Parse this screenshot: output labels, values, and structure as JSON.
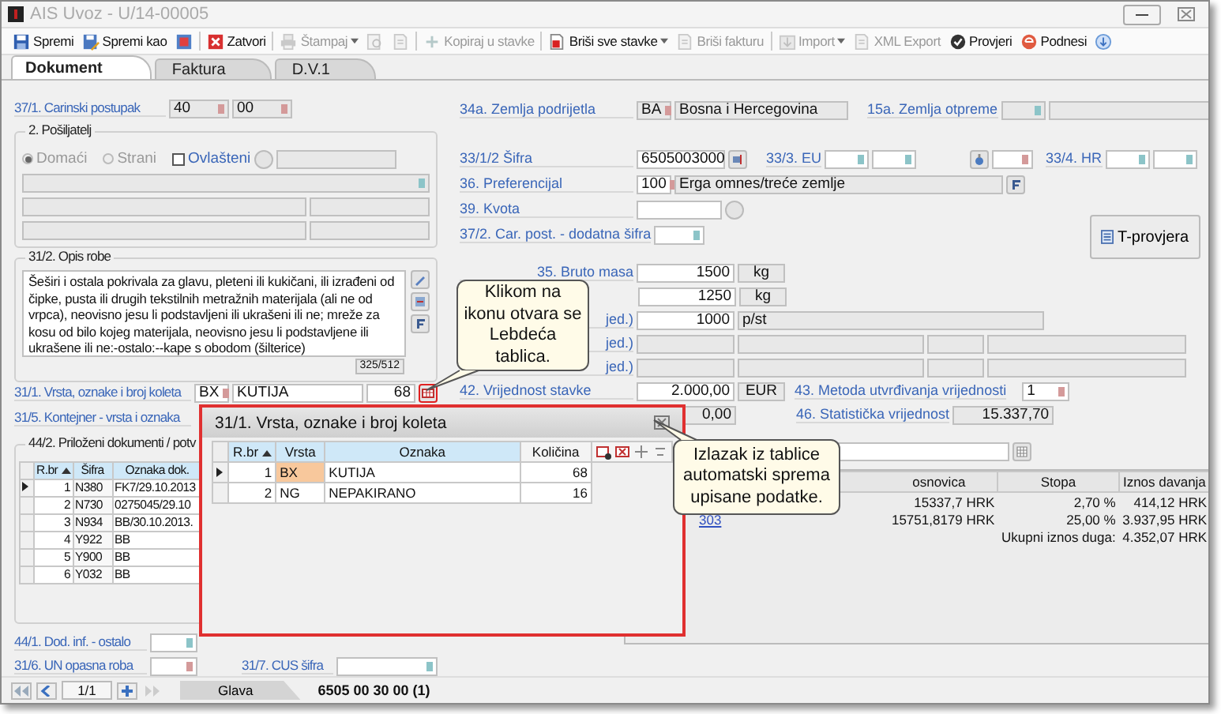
{
  "window": {
    "title": "AIS Uvoz - U/14-00005"
  },
  "toolbar": [
    {
      "kind": "save",
      "label": "Spremi",
      "disabled": false
    },
    {
      "kind": "saveas",
      "label": "Spremi kao",
      "disabled": false
    },
    {
      "kind": "export",
      "disabled": false
    },
    {
      "kind": "separator"
    },
    {
      "kind": "close",
      "label": "Zatvori",
      "disabled": false
    },
    {
      "kind": "separator"
    },
    {
      "kind": "print",
      "label": "Štampaj",
      "disabled": true,
      "dropdown": true
    },
    {
      "kind": "preview",
      "disabled": true
    },
    {
      "kind": "page",
      "disabled": true
    },
    {
      "kind": "separator"
    },
    {
      "kind": "copy",
      "label": "Kopiraj u stavke",
      "disabled": true
    },
    {
      "kind": "separator"
    },
    {
      "kind": "delete",
      "label": "Briši sve stavke",
      "disabled": false,
      "dropdown": true
    },
    {
      "kind": "page",
      "label": "Briši fakturu",
      "disabled": true
    },
    {
      "kind": "separator"
    },
    {
      "kind": "import",
      "label": "Import",
      "disabled": true,
      "dropdown": true
    },
    {
      "kind": "page",
      "label": "XML Export",
      "disabled": true
    },
    {
      "kind": "check",
      "label": "Provjeri",
      "disabled": false
    },
    {
      "kind": "submit",
      "label": "Podnesi",
      "disabled": false
    },
    {
      "kind": "info",
      "disabled": false
    }
  ],
  "tabs": [
    {
      "label": "Dokument",
      "selected": true
    },
    {
      "label": "Faktura",
      "selected": false
    },
    {
      "label": "D.V.1",
      "selected": false
    }
  ],
  "left": {
    "carinski_postupak": {
      "label": "37/1. Carinski postupak",
      "values": [
        "40",
        "00"
      ]
    },
    "posiljatelj": {
      "title": "2. Pošiljatelj",
      "options": [
        {
          "label": "Domaći",
          "selected": true
        },
        {
          "label": "Strani",
          "selected": false
        }
      ],
      "ovlasteni": {
        "label": "Ovlašteni",
        "checked": false
      }
    },
    "opis_robe": {
      "title": "31/2. Opis robe",
      "text": "Šeširi i ostala pokrivala za glavu, pleteni ili kukičani, ili izrađeni od čipke, pusta ili drugih tekstilnih metražnih materijala (ali ne od vrpca), neovisno jesu li podstavljeni ili ukrašeni ili ne; mreže za kosu od bilo kojeg materijala, neovisno jesu li podstavljene ili ukrašene ili ne:-ostalo:--kape s obodom (šilterice)",
      "counter": "325/512"
    },
    "koleta": {
      "label": "31/1. Vrsta, oznake i broj koleta",
      "code": "BX",
      "name": "KUTIJA",
      "count": "68"
    },
    "kontejner": {
      "label": "31/5. Kontejner - vrsta i oznaka"
    },
    "prilozeni": {
      "title": "44/2. Priloženi dokumenti / potv",
      "columns": [
        {
          "label": "R.br",
          "sorted": true
        },
        {
          "label": "Šifra",
          "sorted": false
        },
        {
          "label": "Oznaka dok.",
          "sorted": false
        }
      ],
      "rows": [
        {
          "cells": [
            "1",
            "N380",
            "FK7/29.10.2013"
          ],
          "selected": true
        },
        {
          "cells": [
            "2",
            "N730",
            "0275045/29.10"
          ],
          "selected": false
        },
        {
          "cells": [
            "3",
            "N934",
            "BB/30.10.2013."
          ],
          "selected": false
        },
        {
          "cells": [
            "4",
            "Y922",
            "BB"
          ],
          "selected": false
        },
        {
          "cells": [
            "5",
            "Y900",
            "BB"
          ],
          "selected": false
        },
        {
          "cells": [
            "6",
            "Y032",
            "BB"
          ],
          "selected": false
        }
      ]
    },
    "dod_inf": {
      "label": "44/1. Dod. inf. - ostalo"
    },
    "un_opasna": {
      "label": "31/6. UN opasna roba"
    },
    "cus": {
      "label": "31/7. CUS šifra"
    }
  },
  "right": {
    "zemlja_podrijetla": {
      "label": "34a. Zemlja podrijetla",
      "code": "BA",
      "name": "Bosna i Hercegovina"
    },
    "zemlja_otpreme": {
      "label": "15a. Zemlja otpreme"
    },
    "sifra": {
      "label": "33/1/2 Šifra",
      "value": "6505003000"
    },
    "eu": {
      "label": "33/3. EU"
    },
    "hr": {
      "label": "33/4. HR"
    },
    "preferencijal": {
      "label": "36. Preferencijal",
      "code": "100",
      "name": "Erga omnes/treće zemlje"
    },
    "kvota": {
      "label": "39. Kvota"
    },
    "dodatna_sifra": {
      "label": "37/2. Car. post. - dodatna šifra"
    },
    "t_provjera": {
      "label": "T-provjera"
    },
    "mjere": [
      {
        "kind": "unit_box",
        "label": "35. Bruto masa",
        "value": "1500",
        "unit": "kg"
      },
      {
        "kind": "unit_box",
        "value": "1250",
        "unit": "kg"
      },
      {
        "kind": "unit_field",
        "label": "jed.)",
        "value": "1000",
        "unit": "p/st"
      },
      {
        "kind": "empty",
        "label": "jed.)"
      },
      {
        "kind": "empty",
        "label": "jed.)"
      }
    ],
    "vrijednost": {
      "label": "42. Vrijednost stavke",
      "value": "2.000,00",
      "currency": "EUR"
    },
    "metoda": {
      "label": "43. Metoda utvrđivanja vrijednosti",
      "value": "1"
    },
    "iznos": {
      "value": "0,00"
    },
    "statisticka": {
      "label": "46. Statistička vrijednost",
      "value": "15.337,70"
    },
    "davanja": {
      "columns": [
        "osnovica",
        "Stopa",
        "Iznos davanja"
      ],
      "rows": [
        {
          "cells": [
            "15337,7 HRK",
            "2,70 %",
            "414,12 HRK"
          ]
        },
        {
          "link": "303",
          "cells": [
            "15751,8179 HRK",
            "25,00 %",
            "3.937,95 HRK"
          ]
        }
      ],
      "total_label": "Ukupni iznos duga:",
      "total": "4.352,07 HRK"
    }
  },
  "popup": {
    "title": "31/1. Vrsta, oznake i broj koleta",
    "columns": [
      {
        "label": "R.br",
        "sorted": true
      },
      {
        "label": "Vrsta",
        "sorted": false
      },
      {
        "label": "Oznaka",
        "sorted": false
      },
      {
        "label": "Količina",
        "sorted": false
      }
    ],
    "rows": [
      {
        "no": "1",
        "code": "BX",
        "name": "KUTIJA",
        "qty": "68",
        "selected": true
      },
      {
        "no": "2",
        "code": "NG",
        "name": "NEPAKIRANO",
        "qty": "16",
        "selected": false
      }
    ]
  },
  "callouts": [
    {
      "text": "Klikom na ikonu otvara se Lebdeća tablica."
    },
    {
      "text": "Izlazak iz tablice automatski sprema upisane podatke."
    }
  ],
  "navigator": {
    "position": "1/1",
    "tab": "Glava",
    "tariff": "6505 00 30 00 (1)"
  }
}
